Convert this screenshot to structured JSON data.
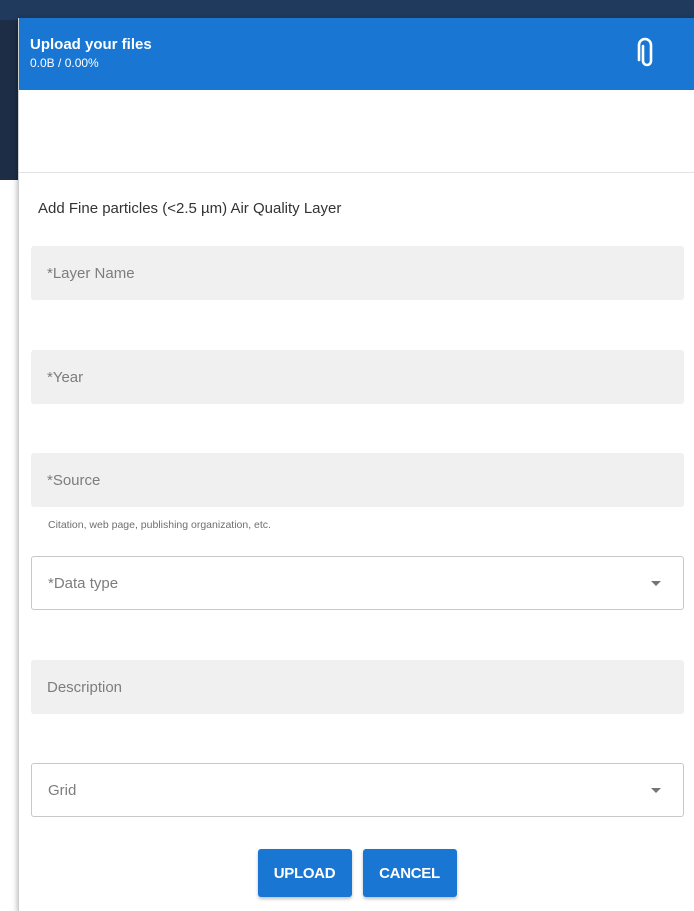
{
  "dialog": {
    "header": {
      "title": "Upload your files",
      "progress": "0.0B / 0.00%",
      "attach_icon": "paperclip-icon"
    },
    "form_title": "Add Fine particles (<2.5 µm) Air Quality Layer",
    "fields": {
      "layer_name": {
        "placeholder": "*Layer Name",
        "value": ""
      },
      "year": {
        "placeholder": "*Year",
        "value": ""
      },
      "source": {
        "placeholder": "*Source",
        "value": "",
        "hint": "Citation, web page, publishing organization, etc."
      },
      "data_type": {
        "placeholder": "*Data type",
        "selected": ""
      },
      "description": {
        "placeholder": "Description",
        "value": ""
      },
      "grid": {
        "placeholder": "Grid",
        "selected": ""
      }
    },
    "actions": {
      "upload_label": "UPLOAD",
      "cancel_label": "CANCEL"
    }
  },
  "colors": {
    "primary": "#1976d2",
    "field_background": "#f0f0f0",
    "placeholder_text": "#7d7d7d"
  }
}
